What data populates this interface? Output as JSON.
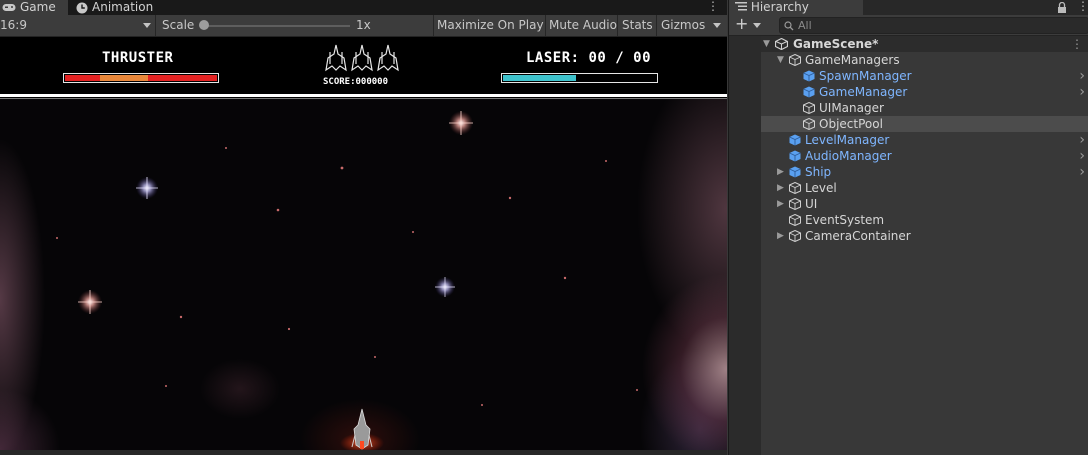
{
  "game_tabs": [
    {
      "label": "Game",
      "icon": "gamepad-icon"
    },
    {
      "label": "Animation",
      "icon": "clock-icon"
    }
  ],
  "game_toolbar": {
    "aspect": "16:9",
    "scale_label": "Scale",
    "scale_value": "1x",
    "maximize": "Maximize On Play",
    "mute": "Mute Audio",
    "stats": "Stats",
    "gizmos": "Gizmos"
  },
  "hud": {
    "thruster_label": "THRUSTER",
    "thruster_level": 0.55,
    "score_label": "SCORE:000000",
    "laser_label": "LASER: 00 / 00",
    "laser_level": 0.48,
    "lives": 3,
    "colors": {
      "thruster": "#e32222",
      "thruster_boost": "#e8873a",
      "laser": "#3ec2cc"
    }
  },
  "hierarchy": {
    "tab_label": "Hierarchy",
    "add_label": "+",
    "search_placeholder": "All",
    "scene": "GameScene*",
    "items": [
      {
        "label": "GameManagers",
        "depth": 1,
        "expanded": true,
        "prefab": false,
        "chevron": false
      },
      {
        "label": "SpawnManager",
        "depth": 2,
        "prefab": true,
        "chevron": true
      },
      {
        "label": "GameManager",
        "depth": 2,
        "prefab": true,
        "chevron": true
      },
      {
        "label": "UIManager",
        "depth": 2,
        "prefab": false,
        "chevron": false
      },
      {
        "label": "ObjectPool",
        "depth": 2,
        "prefab": false,
        "chevron": false,
        "selected": true
      },
      {
        "label": "LevelManager",
        "depth": 1,
        "prefab": true,
        "chevron": true
      },
      {
        "label": "AudioManager",
        "depth": 1,
        "prefab": true,
        "chevron": true
      },
      {
        "label": "Ship",
        "depth": 1,
        "prefab": true,
        "chevron": true,
        "collapsed": true
      },
      {
        "label": "Level",
        "depth": 1,
        "prefab": false,
        "chevron": false,
        "collapsed": true
      },
      {
        "label": "UI",
        "depth": 1,
        "prefab": false,
        "chevron": false,
        "collapsed": true
      },
      {
        "label": "EventSystem",
        "depth": 1,
        "prefab": false,
        "chevron": false
      },
      {
        "label": "CameraContainer",
        "depth": 1,
        "prefab": false,
        "chevron": false,
        "collapsed": true
      }
    ]
  }
}
